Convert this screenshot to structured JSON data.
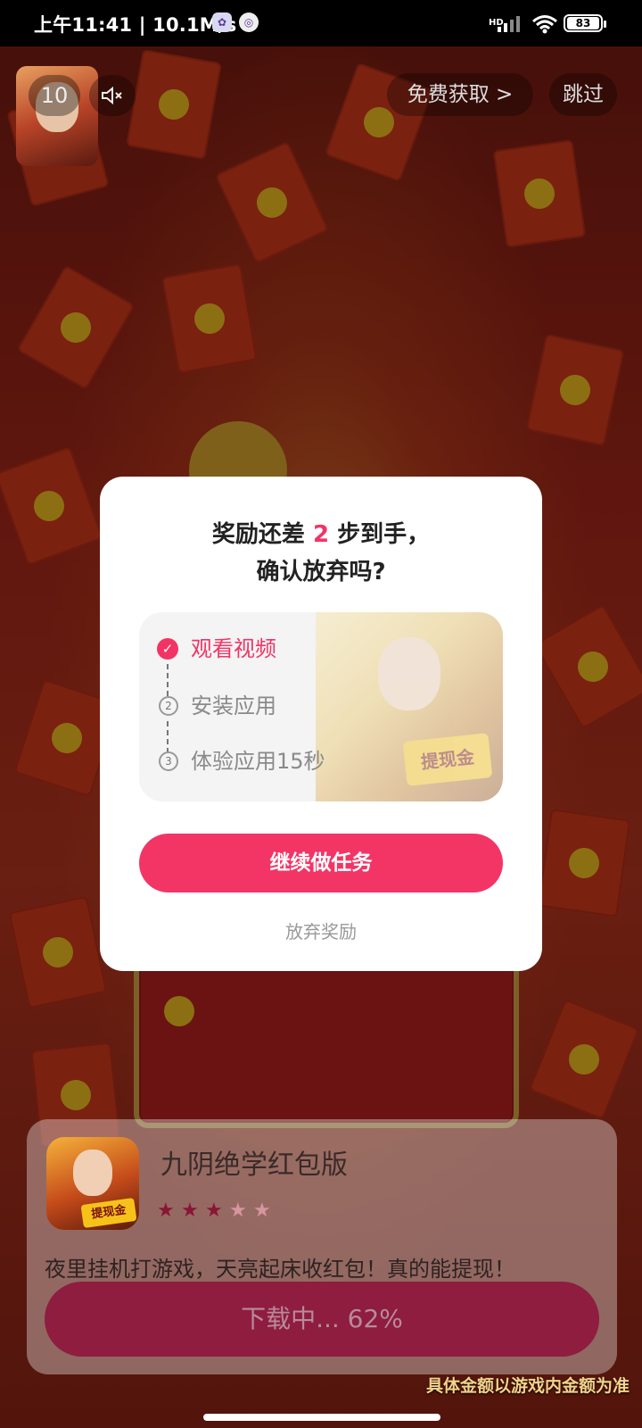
{
  "status_bar": {
    "time": "上午11:41",
    "net_speed": "10.1M/s",
    "network_type": "HD",
    "battery": "83"
  },
  "ad": {
    "countdown": "10",
    "mute_icon": "speaker-muted-icon",
    "free_get_label": "免费获取 >",
    "skip_label": "跳过"
  },
  "dialog": {
    "title_line1_prefix": "奖励还差 ",
    "title_line1_count": "2",
    "title_line1_suffix": " 步到手，",
    "title_line2": "确认放弃吗?",
    "steps": [
      {
        "label": "观看视频",
        "done": true,
        "marker": "✓"
      },
      {
        "label": "安装应用",
        "done": false,
        "marker": "2"
      },
      {
        "label": "体验应用15秒",
        "done": false,
        "marker": "3"
      }
    ],
    "promo_badge": "提现金",
    "continue_label": "继续做任务",
    "giveup_label": "放弃奖励",
    "accent_color": "#f33566"
  },
  "app_card": {
    "name": "九阴绝学红包版",
    "rating": 3,
    "rating_max": 5,
    "icon_badge": "提现金",
    "description": "夜里挂机打游戏，天亮起床收红包！真的能提现！",
    "download_label": "下载中... 62%",
    "download_progress": 0.62
  },
  "disclaimer": "具体金额以游戏内金额为准"
}
